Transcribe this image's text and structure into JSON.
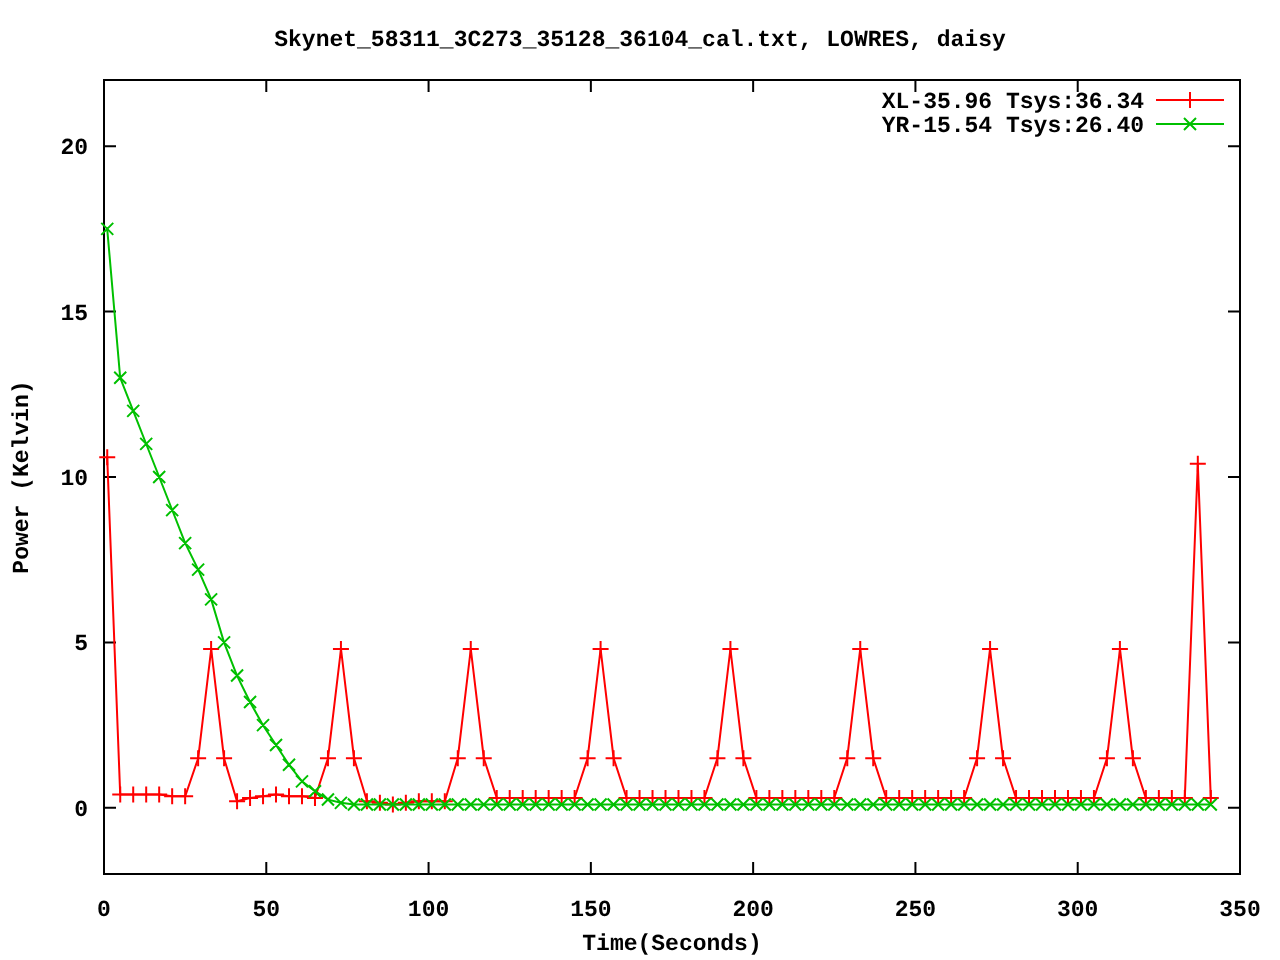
{
  "chart_data": {
    "type": "line",
    "title": "Skynet_58311_3C273_35128_36104_cal.txt, LOWRES, daisy",
    "xlabel": "Time(Seconds)",
    "ylabel": "Power (Kelvin)",
    "xlim": [
      0,
      350
    ],
    "ylim": [
      -2,
      22
    ],
    "legend": true,
    "xticks": [
      0,
      50,
      100,
      150,
      200,
      250,
      300,
      350
    ],
    "yticks": [
      0,
      5,
      10,
      15,
      20
    ],
    "x": [
      1,
      5,
      9,
      13,
      17,
      21,
      25,
      29,
      33,
      37,
      41,
      45,
      49,
      53,
      57,
      61,
      65,
      69,
      73,
      77,
      81,
      85,
      89,
      93,
      97,
      101,
      105,
      109,
      113,
      117,
      121,
      125,
      129,
      133,
      137,
      141,
      145,
      149,
      153,
      157,
      161,
      165,
      169,
      173,
      177,
      181,
      185,
      189,
      193,
      197,
      201,
      205,
      209,
      213,
      217,
      221,
      225,
      229,
      233,
      237,
      241,
      245,
      249,
      253,
      257,
      261,
      265,
      269,
      273,
      277,
      281,
      285,
      289,
      293,
      297,
      301,
      305,
      309,
      313,
      317,
      321,
      325,
      329,
      333,
      337,
      341
    ],
    "series": [
      {
        "name": "XL-35.96 Tsys:36.34",
        "color": "#ff0000",
        "marker": "plus",
        "values": [
          10.6,
          0.4,
          0.4,
          0.4,
          0.4,
          0.35,
          0.35,
          1.5,
          4.8,
          1.5,
          0.2,
          0.3,
          0.35,
          0.4,
          0.35,
          0.35,
          0.3,
          1.5,
          4.8,
          1.5,
          0.2,
          0.15,
          0.1,
          0.15,
          0.2,
          0.2,
          0.2,
          1.5,
          4.8,
          1.5,
          0.3,
          0.3,
          0.3,
          0.3,
          0.3,
          0.3,
          0.3,
          1.5,
          4.8,
          1.5,
          0.3,
          0.3,
          0.3,
          0.3,
          0.3,
          0.3,
          0.3,
          1.5,
          4.8,
          1.5,
          0.3,
          0.3,
          0.3,
          0.3,
          0.3,
          0.3,
          0.3,
          1.5,
          4.8,
          1.5,
          0.3,
          0.3,
          0.3,
          0.3,
          0.3,
          0.3,
          0.3,
          1.5,
          4.8,
          1.5,
          0.3,
          0.3,
          0.3,
          0.3,
          0.3,
          0.3,
          0.3,
          1.5,
          4.8,
          1.5,
          0.3,
          0.3,
          0.3,
          0.3,
          10.4,
          0.3
        ]
      },
      {
        "name": "YR-15.54 Tsys:26.40",
        "color": "#00c000",
        "marker": "cross",
        "values": [
          17.5,
          13,
          12,
          11,
          10,
          9,
          8,
          7.2,
          6.3,
          5,
          4,
          3.2,
          2.5,
          1.9,
          1.3,
          0.8,
          0.5,
          0.25,
          0.15,
          0.1,
          0.1,
          0.1,
          0.1,
          0.1,
          0.1,
          0.1,
          0.1,
          0.1,
          0.1,
          0.1,
          0.1,
          0.1,
          0.1,
          0.1,
          0.1,
          0.1,
          0.1,
          0.1,
          0.1,
          0.1,
          0.1,
          0.1,
          0.1,
          0.1,
          0.1,
          0.1,
          0.1,
          0.1,
          0.1,
          0.1,
          0.1,
          0.1,
          0.1,
          0.1,
          0.1,
          0.1,
          0.1,
          0.1,
          0.1,
          0.1,
          0.1,
          0.1,
          0.1,
          0.1,
          0.1,
          0.1,
          0.1,
          0.1,
          0.1,
          0.1,
          0.1,
          0.1,
          0.1,
          0.1,
          0.1,
          0.1,
          0.1,
          0.1,
          0.1,
          0.1,
          0.1,
          0.1,
          0.1,
          0.1,
          0.1,
          0.1
        ]
      }
    ]
  }
}
